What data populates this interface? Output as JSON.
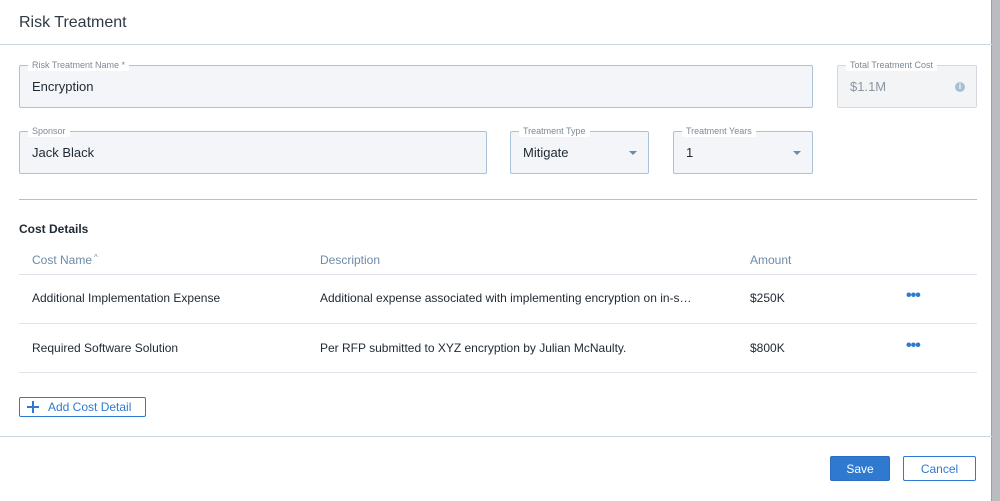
{
  "dialog": {
    "title": "Risk Treatment"
  },
  "form": {
    "treatment_name": {
      "label": "Risk Treatment Name *",
      "value": "Encryption"
    },
    "total_cost": {
      "label": "Total Treatment Cost",
      "value": "$1.1M"
    },
    "sponsor": {
      "label": "Sponsor",
      "value": "Jack Black"
    },
    "treatment_type": {
      "label": "Treatment Type",
      "value": "Mitigate"
    },
    "treatment_years": {
      "label": "Treatment Years",
      "value": "1"
    }
  },
  "cost_details": {
    "title": "Cost Details",
    "columns": {
      "name": "Cost Name",
      "sort_indicator": "^",
      "description": "Description",
      "amount": "Amount"
    },
    "rows": [
      {
        "name": "Additional Implementation Expense",
        "description": "Additional expense associated with implementing encryption on in-s…",
        "amount": "$250K"
      },
      {
        "name": "Required Software Solution",
        "description": "Per RFP submitted to XYZ encryption by Julian McNaulty.",
        "amount": "$800K"
      }
    ],
    "add_label": "Add Cost Detail"
  },
  "footer": {
    "save_label": "Save",
    "cancel_label": "Cancel"
  },
  "icons": {
    "more": "more-horizontal-icon",
    "add": "plus-icon",
    "info": "info-icon",
    "dropdown": "chevron-down-icon"
  },
  "colors": {
    "accent": "#2f7ad0",
    "field_border": "#a9c1d9",
    "muted_label": "#6f8aa8"
  }
}
